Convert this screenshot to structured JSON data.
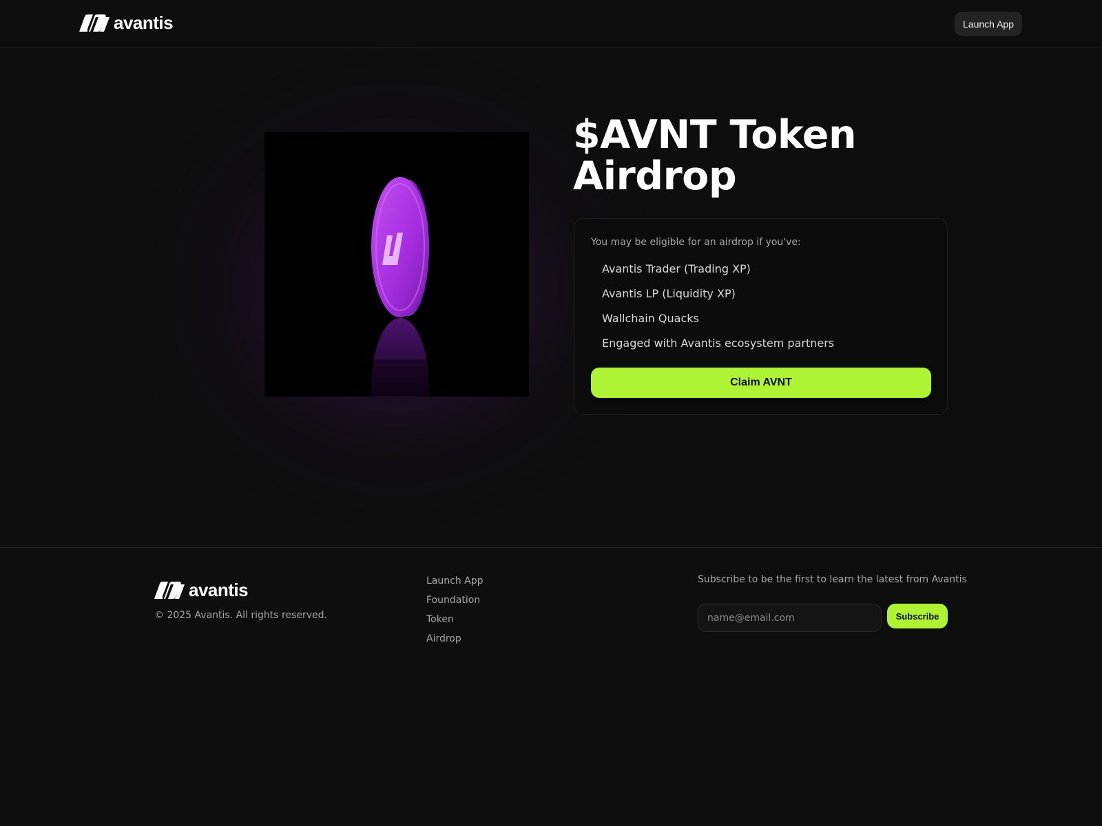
{
  "brand": {
    "name": "avantis",
    "accent_color": "#aef334",
    "coin_color": "#b23ce6"
  },
  "header": {
    "launch_label": "Launch App"
  },
  "hero": {
    "title": "$AVNT Token Airdrop",
    "image_icon": "purple-coin-image"
  },
  "eligibility": {
    "intro": "You may be eligible for an airdrop if you've:",
    "criteria": [
      "Avantis Trader (Trading XP)",
      "Avantis LP (Liquidity XP)",
      "Wallchain Quacks",
      "Engaged with Avantis ecosystem partners"
    ],
    "claim_label": "Claim AVNT"
  },
  "footer": {
    "copyright": "© 2025 Avantis. All rights reserved.",
    "links": [
      "Launch App",
      "Foundation",
      "Token",
      "Airdrop"
    ],
    "subscribe_text": "Subscribe to be the first to learn the latest from Avantis",
    "email_placeholder": "name@email.com",
    "subscribe_label": "Subscribe"
  }
}
